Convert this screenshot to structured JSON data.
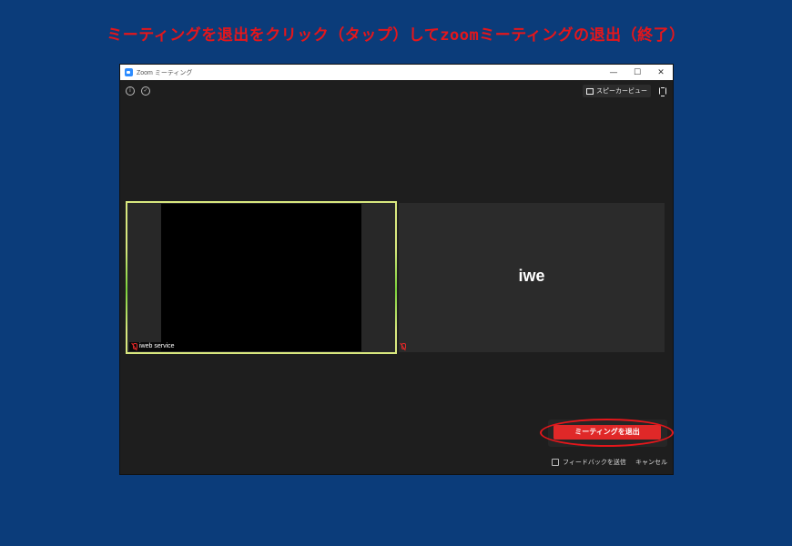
{
  "headline": "ミーティングを退出をクリック（タップ）してzoomミーティングの退出（終了）",
  "window": {
    "title": "Zoom ミーティング",
    "controls": {
      "minimize": "—",
      "maximize": "☐",
      "close": "✕"
    }
  },
  "topbar": {
    "speaker_view_label": "スピーカービュー"
  },
  "participants": [
    {
      "name": "iweb service",
      "mic": "muted"
    },
    {
      "display_name": "iwe",
      "mic": "muted"
    }
  ],
  "leave_dialog": {
    "leave_button": "ミーティングを退出",
    "feedback_label": "フィードバックを送信",
    "cancel_label": "キャンセル"
  },
  "colors": {
    "background": "#0b3c7a",
    "headline": "#e5161b",
    "leave_button": "#e02828",
    "active_speaker_border": "#d8e77e"
  }
}
